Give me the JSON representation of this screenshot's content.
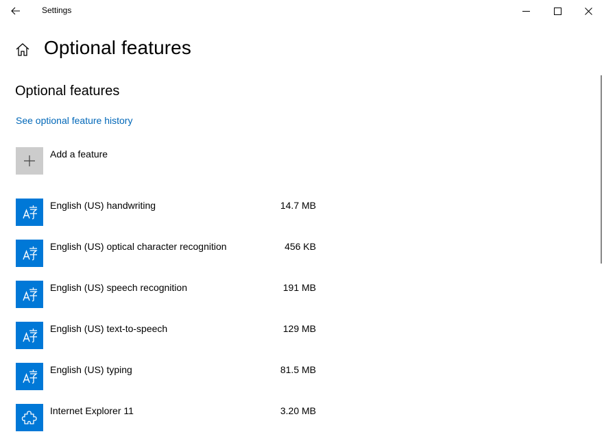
{
  "window": {
    "title": "Settings"
  },
  "page": {
    "title": "Optional features",
    "section_title": "Optional features",
    "history_link": "See optional feature history",
    "add_feature_label": "Add a feature"
  },
  "features": [
    {
      "name": "English (US) handwriting",
      "size": "14.7 MB",
      "icon": "language-icon"
    },
    {
      "name": "English (US) optical character recognition",
      "size": "456 KB",
      "icon": "language-icon"
    },
    {
      "name": "English (US) speech recognition",
      "size": "191 MB",
      "icon": "language-icon"
    },
    {
      "name": "English (US) text-to-speech",
      "size": "129 MB",
      "icon": "language-icon"
    },
    {
      "name": "English (US) typing",
      "size": "81.5 MB",
      "icon": "language-icon"
    },
    {
      "name": "Internet Explorer 11",
      "size": "3.20 MB",
      "icon": "puzzle-icon"
    }
  ],
  "colors": {
    "accent": "#0078d7",
    "link": "#0067b8",
    "add_tile": "#cccccc"
  }
}
